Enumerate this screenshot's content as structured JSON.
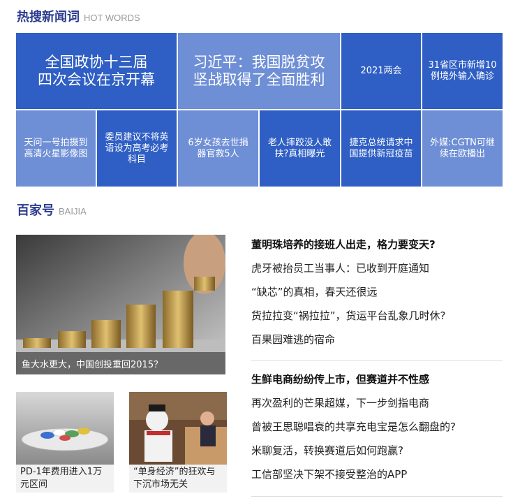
{
  "hot": {
    "title": "热搜新闻词",
    "subtitle": "HOT WORDS",
    "tiles": [
      {
        "line1": "全国政协十三届",
        "line2": "四次会议在京开幕"
      },
      {
        "line1": "习近平：我国脱贫攻",
        "line2": "坚战取得了全面胜利"
      },
      {
        "line1": "2021两会",
        "line2": ""
      },
      {
        "line1": "31省区市新增10",
        "line2": "例境外输入确诊"
      },
      {
        "line1": "天问一号拍摄到",
        "line2": "高清火星影像图"
      },
      {
        "line1": "委员建议不将英",
        "line2": "语设为高考必考",
        "line3": "科目"
      },
      {
        "line1": "6岁女孩去世捐",
        "line2": "器官救5人"
      },
      {
        "line1": "老人摔跤没人敢",
        "line2": "扶?真相曝光"
      },
      {
        "line1": "捷克总统请求中",
        "line2": "国提供新冠疫苗"
      },
      {
        "line1": "外媒:CGTN可继",
        "line2": "续在欧播出"
      }
    ],
    "colors": {
      "dark": "#2f5fc4",
      "light": "#6e8fd6"
    }
  },
  "baijia": {
    "title": "百家号",
    "subtitle": "BAIJIA",
    "main_image": {
      "icon": "coins-photo",
      "caption": "鱼大水更大，中国创投重回2015？"
    },
    "small_cards": [
      {
        "icon": "pills-photo",
        "caption": "PD-1年费用进入1万元区间"
      },
      {
        "icon": "snowman-cafe-photo",
        "caption": "“单身经济”的狂欢与下沉市场无关"
      }
    ],
    "group1": [
      "董明珠培养的接班人出走，格力要变天?",
      "虎牙被抬员工当事人：已收到开庭通知",
      "“缺芯”的真相，春天还很远",
      "货拉拉变“祸拉拉”，货运平台乱象几时休?",
      "百果园难逃的宿命"
    ],
    "group2": [
      "生鲜电商纷纷传上市，但赛道并不性感",
      "再次盈利的芒果超媒，下一步剑指电商",
      "曾被王思聪唱衰的共享充电宝是怎么翻盘的?",
      "米聊复活，转换赛道后如何跑赢?",
      "工信部坚决下架不接受整治的APP"
    ]
  }
}
